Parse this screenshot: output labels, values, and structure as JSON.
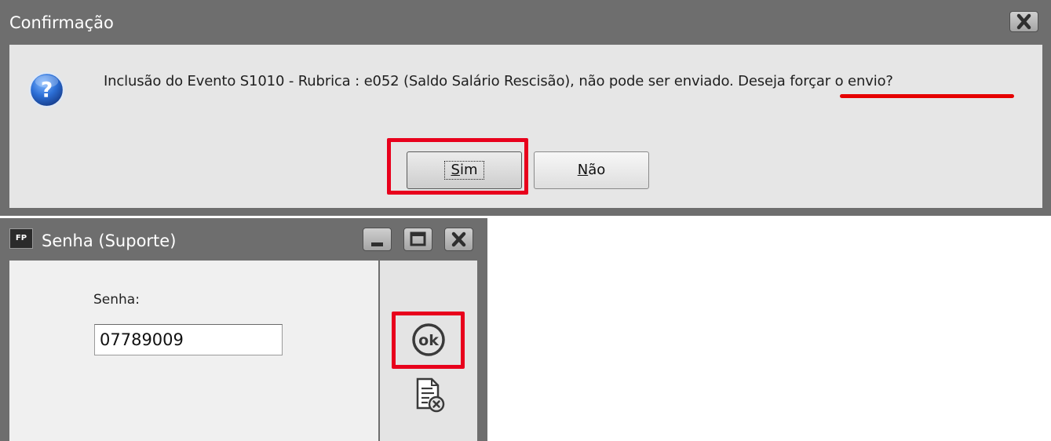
{
  "confirm_dialog": {
    "title": "Confirmação",
    "message_part1": "Inclusão do Evento S1010 - Rubrica : e052 (Saldo Salário Rescisão), não pode ser enviado. ",
    "message_part2": "Deseja forçar o envio?",
    "yes_button": {
      "accel": "S",
      "rest": "im"
    },
    "no_button": {
      "accel": "N",
      "rest": "ão"
    },
    "icon": "question-icon"
  },
  "password_window": {
    "app_badge": "FP",
    "title": "Senha (Suporte)",
    "password_label": "Senha:",
    "password_value": "07789009",
    "ok_icon_text": "ok",
    "cancel_icon": "document-cancel-icon"
  },
  "colors": {
    "highlight": "#e8001c",
    "titlebar": "#6e6e6e"
  }
}
